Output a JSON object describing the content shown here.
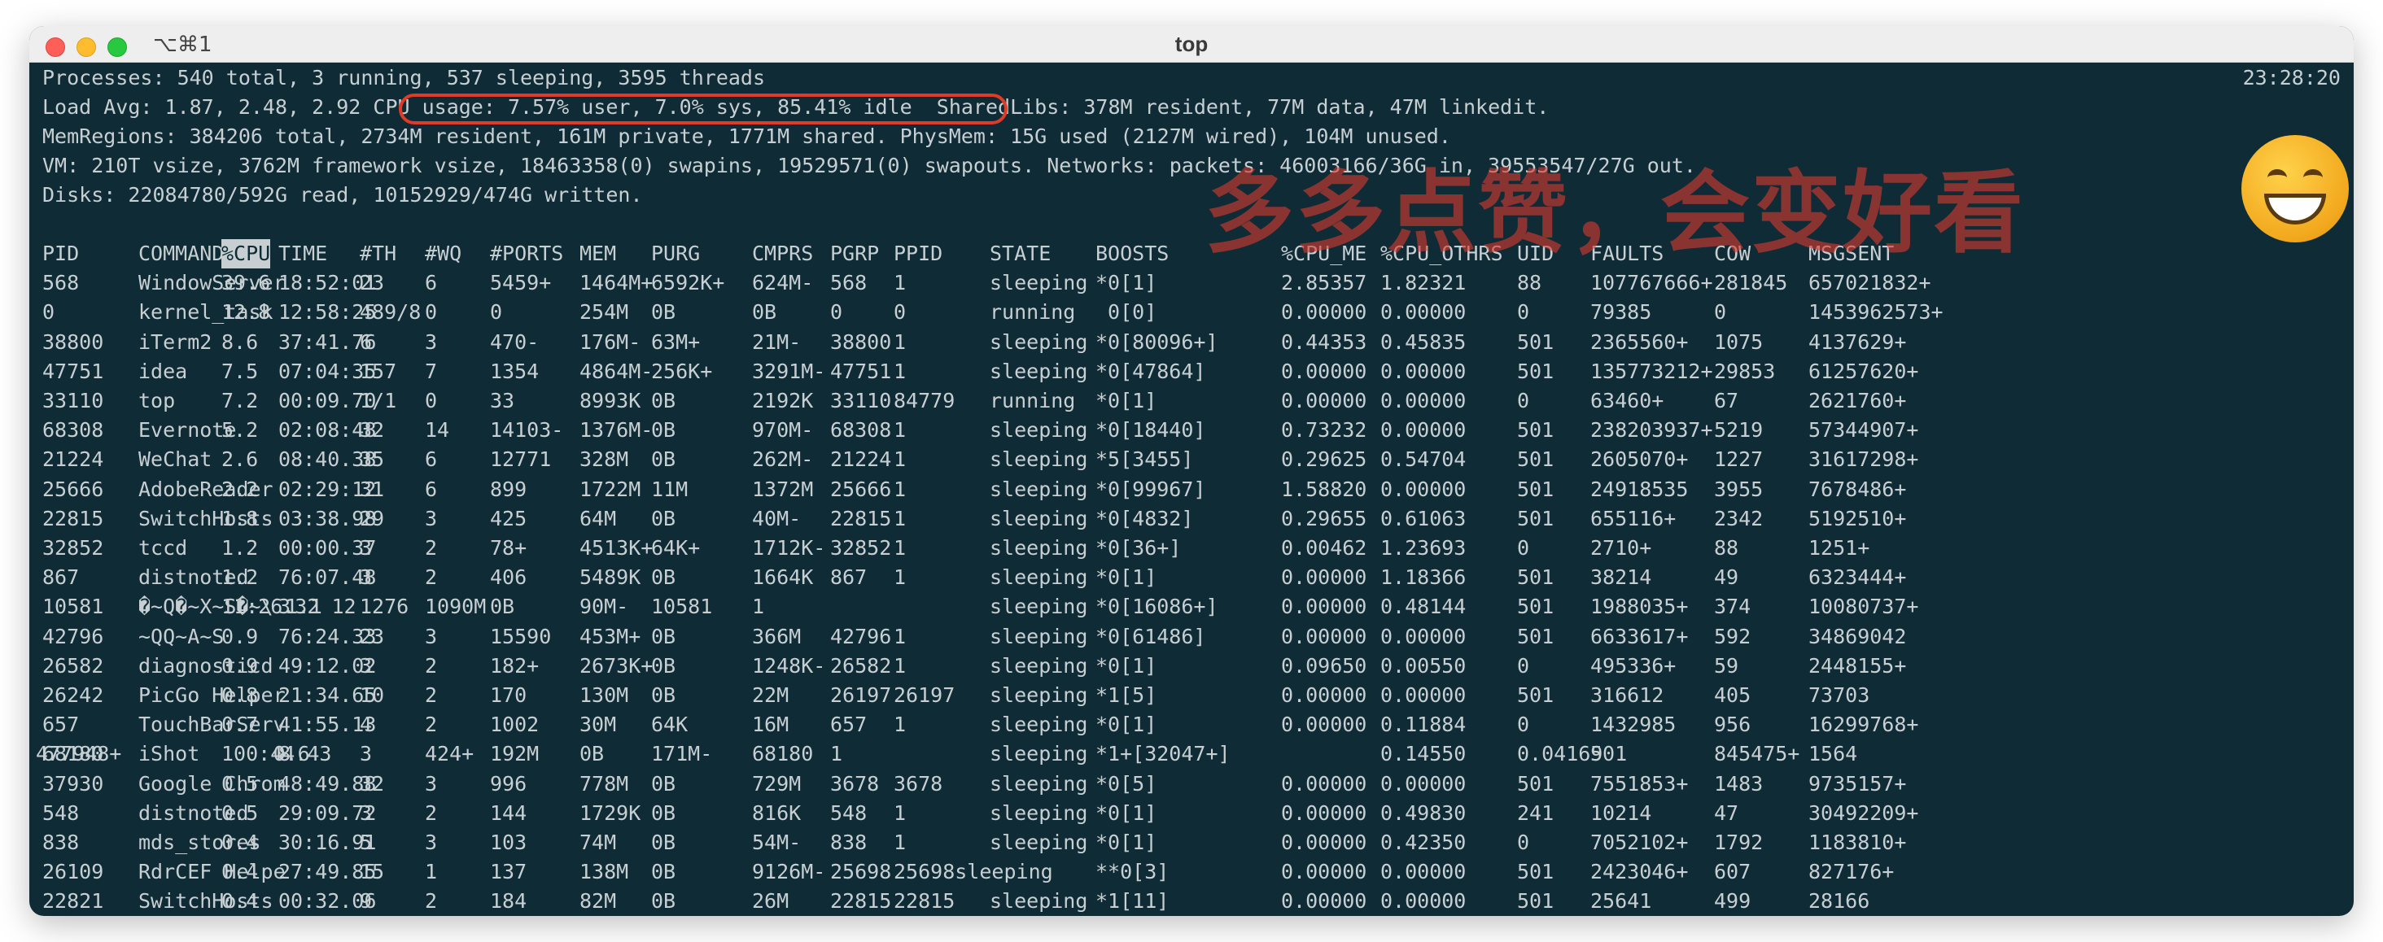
{
  "window": {
    "title": "top",
    "shortcut": "⌥⌘1"
  },
  "summary": {
    "processes": "Processes: 540 total, 3 running, 537 sleeping, 3595 threads",
    "clock": "23:28:20",
    "load_prefix": "Load Avg: 1.87, 2.48, 2.92 ",
    "cpu_usage": "CPU usage: 7.57% user, 7.0% sys, 85.41% idle",
    "sharedlibs": "SharedLibs: 378M resident, 77M data, 47M linkedit.",
    "memregions": "MemRegions: 384206 total, 2734M resident, 161M private, 1771M shared. PhysMem: 15G used (2127M wired), 104M unused.",
    "vm": "VM: 210T vsize, 3762M framework vsize, 18463358(0) swapins, 19529571(0) swapouts. Networks: packets: 46003166/36G in, 39553547/27G out.",
    "disks": "Disks: 22084780/592G read, 10152929/474G written."
  },
  "overlay_text": "多多点赞，会变好看",
  "columns": [
    "PID",
    "COMMAND",
    "%CPU",
    "TIME",
    "#TH",
    "#WQ",
    "#PORTS",
    "MEM",
    "PURG",
    "CMPRS",
    "PGRP",
    "PPID",
    "STATE",
    "BOOSTS",
    "%CPU_ME",
    "%CPU_OTHRS",
    "UID",
    "FAULTS",
    "COW",
    "MSGSENT"
  ],
  "sorted_column": "%CPU",
  "rows": [
    [
      "568",
      "WindowServer",
      "39.6",
      "18:52:01",
      "23",
      "6",
      "5459+",
      "1464M+",
      "6592K+",
      "624M-",
      "568",
      "1",
      "sleeping",
      "*0[1]",
      "2.85357",
      "1.82321",
      "88",
      "107767666+",
      "281845",
      "657021832+"
    ],
    [
      "0",
      "kernel_task",
      "12.8",
      "12:58:25",
      "489/8",
      "0",
      "0",
      "254M",
      "0B",
      "0B",
      "0",
      "0",
      "running",
      " 0[0]",
      "0.00000",
      "0.00000",
      "0",
      "79385",
      "0",
      "1453962573+"
    ],
    [
      "38800",
      "iTerm2",
      "8.6",
      "37:41.76",
      "6",
      "3",
      "470-",
      "176M-",
      "63M+",
      "21M-",
      "38800",
      "1",
      "sleeping",
      "*0[80096+]",
      "0.44353",
      "0.45835",
      "501",
      "2365560+",
      "1075",
      "4137629+"
    ],
    [
      "47751",
      "idea",
      "7.5",
      "07:04:35",
      "157",
      "7",
      "1354",
      "4864M-",
      "256K+",
      "3291M-",
      "47751",
      "1",
      "sleeping",
      "*0[47864]",
      "0.00000",
      "0.00000",
      "501",
      "135773212+",
      "29853",
      "61257620+"
    ],
    [
      "33110",
      "top",
      "7.2",
      "00:09.70",
      "1/1",
      "0",
      "33",
      "8993K",
      "0B",
      "2192K",
      "33110",
      "84779",
      "running",
      "*0[1]",
      "0.00000",
      "0.00000",
      "0",
      "63460+",
      "67",
      "2621760+"
    ],
    [
      "68308",
      "Evernote",
      "5.2",
      "02:08:48",
      "32",
      "14",
      "14103-",
      "1376M-",
      "0B",
      "970M-",
      "68308",
      "1",
      "sleeping",
      "*0[18440]",
      "0.73232",
      "0.00000",
      "501",
      "238203937+",
      "5219",
      "57344907+"
    ],
    [
      "21224",
      "WeChat",
      "2.6",
      "08:40.38",
      "35",
      "6",
      "12771",
      "328M",
      "0B",
      "262M-",
      "21224",
      "1",
      "sleeping",
      "*5[3455]",
      "0.29625",
      "0.54704",
      "501",
      "2605070+",
      "1227",
      "31617298+"
    ],
    [
      "25666",
      "AdobeReader",
      "2.2",
      "02:29:12",
      "31",
      "6",
      "899",
      "1722M",
      "11M",
      "1372M",
      "25666",
      "1",
      "sleeping",
      "*0[99967]",
      "1.58820",
      "0.00000",
      "501",
      "24918535",
      "3955",
      "7678486+"
    ],
    [
      "22815",
      "SwitchHosts",
      "1.8",
      "03:38.98",
      "29",
      "3",
      "425",
      "64M",
      "0B",
      "40M-",
      "22815",
      "1",
      "sleeping",
      "*0[4832]",
      "0.29655",
      "0.61063",
      "501",
      "655116+",
      "2342",
      "5192510+"
    ],
    [
      "32852",
      "tccd",
      "1.2",
      "00:00.37",
      "3",
      "2",
      "78+",
      "4513K+",
      "64K+",
      "1712K-",
      "32852",
      "1",
      "sleeping",
      "*0[36+]",
      "0.00462",
      "1.23693",
      "0",
      "2710+",
      "88",
      "1251+"
    ],
    [
      "867",
      "distnoted",
      "1.2",
      "76:07.48",
      "3",
      "2",
      "406",
      "5489K",
      "0B",
      "1664K",
      "867",
      "1",
      "sleeping",
      "*0[1]",
      "0.00000",
      "1.18366",
      "501",
      "38214",
      "49",
      "6323444+"
    ],
    [
      "10581",
      "�~Q�~X~S�~\\ 1.1",
      "11:26.32 12",
      "3",
      "1276",
      "1090M",
      "0B",
      "90M-",
      "10581",
      "1",
      "",
      "",
      "sleeping",
      "*0[16086+]",
      "0.00000",
      "0.48144",
      "501",
      "1988035+",
      "374",
      "10080737+"
    ],
    [
      "42796",
      "~QQ~A~S",
      "0.9",
      "76:24.33",
      "23",
      "3",
      "15590",
      "453M+",
      "0B",
      "366M",
      "42796",
      "1",
      "sleeping",
      "*0[61486]",
      "0.00000",
      "0.00000",
      "501",
      "6633617+",
      "592",
      "34869042"
    ],
    [
      "26582",
      "diagnosticd",
      "0.9",
      "49:12.02",
      "3",
      "2",
      "182+",
      "2673K+",
      "0B",
      "1248K-",
      "26582",
      "1",
      "sleeping",
      "*0[1]",
      "0.09650",
      "0.00550",
      "0",
      "495336+",
      "59",
      "2448155+"
    ],
    [
      "26242",
      "PicGo Helper",
      "0.8",
      "21:34.65",
      "10",
      "2",
      "170",
      "130M",
      "0B",
      "22M",
      "26197",
      "26197",
      "sleeping",
      "*1[5]",
      "0.00000",
      "0.00000",
      "501",
      "316612",
      "405",
      "73703"
    ],
    [
      "657",
      "TouchBarServ",
      "0.7",
      "41:55.13",
      "4",
      "2",
      "1002",
      "30M",
      "64K",
      "16M",
      "657",
      "1",
      "sleeping",
      "*0[1]",
      "0.00000",
      "0.11884",
      "0",
      "1432985",
      "956",
      "16299768+"
    ],
    [
      "68180",
      "iShot      0.6",
      "100:44.43",
      "8",
      "3",
      "424+",
      "192M",
      "0B",
      "171M-",
      "68180",
      "1",
      "",
      "sleeping",
      "*1+[32047+]",
      "",
      "0.14550",
      "0.04169",
      "501",
      "845475+",
      "1564",
      "477948+"
    ],
    [
      "37930",
      "Google Chrom",
      "0.5",
      "48:49.88",
      "32",
      "3",
      "996",
      "778M",
      "0B",
      "729M",
      "3678",
      "3678",
      "sleeping",
      "*0[5]",
      "0.00000",
      "0.00000",
      "501",
      "7551853+",
      "1483",
      "9735157+"
    ],
    [
      "548",
      "distnoted",
      "0.5",
      "29:09.72",
      "3",
      "2",
      "144",
      "1729K",
      "0B",
      "816K",
      "548",
      "1",
      "sleeping",
      "*0[1]",
      "0.00000",
      "0.49830",
      "241",
      "10214",
      "47",
      "30492209+"
    ],
    [
      "838",
      "mds_stores",
      "0.4",
      "30:16.91",
      "5",
      "3",
      "103",
      "74M",
      "0B",
      "54M-",
      "838",
      "1",
      "sleeping",
      "*0[1]",
      "0.00000",
      "0.42350",
      "0",
      "7052102+",
      "1792",
      "1183810+"
    ],
    [
      "26109",
      "RdrCEF Helpe",
      "0.4",
      "27:49.85",
      "15",
      "1",
      "137",
      "138M",
      "0B",
      "9126M-",
      "25698",
      "25698sleeping",
      "",
      "**0[3]",
      "0.00000",
      "0.00000",
      "501",
      "2423046+",
      "607",
      "827176+"
    ],
    [
      "22821",
      "SwitchHosts",
      "0.4",
      "00:32.06",
      "9",
      "2",
      "184",
      "82M",
      "0B",
      "26M",
      "22815",
      "22815",
      "sleeping",
      "*1[11]",
      "0.00000",
      "0.00000",
      "501",
      "25641",
      "499",
      "28166"
    ]
  ]
}
